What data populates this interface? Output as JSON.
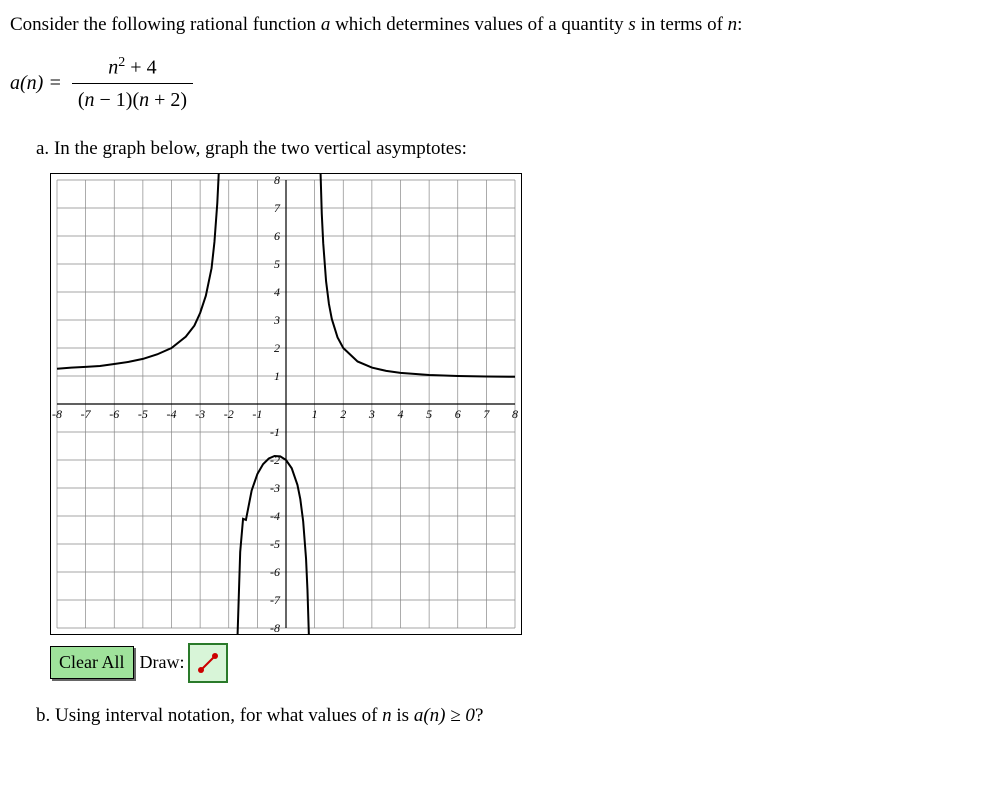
{
  "intro_prefix": "Consider the following rational function ",
  "intro_var1": "a",
  "intro_mid": " which determines values of a quantity ",
  "intro_var2": "s",
  "intro_mid2": " in terms of ",
  "intro_var3": "n",
  "intro_suffix": ":",
  "func_left": "a(n) = ",
  "numerator": "n² + 4",
  "denominator": "(n − 1)(n + 2)",
  "part_a_label": "a. ",
  "part_a_text": "In the graph below, graph the two vertical asymptotes:",
  "clear_label": "Clear All",
  "draw_label": "Draw:",
  "part_b_label": "b. ",
  "part_b_prefix": "Using interval notation, for what values of ",
  "part_b_var": "n",
  "part_b_mid": " is ",
  "part_b_fn": "a(n) ≥ 0",
  "part_b_suffix": "?",
  "chart_data": {
    "type": "line",
    "title": "",
    "xlabel": "",
    "ylabel": "",
    "xlim": [
      -8,
      8
    ],
    "ylim": [
      -8,
      8
    ],
    "xticks": [
      -8,
      -7,
      -6,
      -5,
      -4,
      -3,
      -2,
      -1,
      1,
      2,
      3,
      4,
      5,
      6,
      7,
      8
    ],
    "yticks": [
      -8,
      -7,
      -6,
      -5,
      -4,
      -3,
      -2,
      -1,
      1,
      2,
      3,
      4,
      5,
      6,
      7,
      8
    ],
    "vertical_asymptotes": [
      -2,
      1
    ],
    "horizontal_asymptote": 1,
    "function": "(n^2 + 4) / ((n - 1)(n + 2))",
    "curves": [
      {
        "name": "left_branch",
        "description": "x < -2",
        "points": [
          [
            -8.0,
            1.259
          ],
          [
            -7.5,
            1.3
          ],
          [
            -7.0,
            1.325
          ],
          [
            -6.5,
            1.358
          ],
          [
            -6.0,
            1.429
          ],
          [
            -5.5,
            1.504
          ],
          [
            -5.0,
            1.611
          ],
          [
            -4.5,
            1.773
          ],
          [
            -4.0,
            2.0
          ],
          [
            -3.5,
            2.405
          ],
          [
            -3.2,
            2.8
          ],
          [
            -3.0,
            3.25
          ],
          [
            -2.8,
            3.867
          ],
          [
            -2.6,
            4.852
          ],
          [
            -2.5,
            5.786
          ],
          [
            -2.4,
            7.176
          ],
          [
            -2.3,
            9.288
          ],
          [
            -2.25,
            11.019
          ]
        ]
      },
      {
        "name": "middle_branch",
        "description": "-2 < x < 1",
        "points": [
          [
            -1.85,
            -16.965
          ],
          [
            -1.8,
            -12.964
          ],
          [
            -1.7,
            -8.506
          ],
          [
            -1.6,
            -5.282
          ],
          [
            -1.5,
            -4.1
          ],
          [
            -1.4,
            -4.139
          ],
          [
            -1.2,
            -3.091
          ],
          [
            -1.0,
            -2.5
          ],
          [
            -0.8,
            -2.148
          ],
          [
            -0.6,
            -1.946
          ],
          [
            -0.4,
            -1.857
          ],
          [
            -0.2,
            -1.87
          ],
          [
            0.0,
            -2.0
          ],
          [
            0.2,
            -2.295
          ],
          [
            0.4,
            -2.889
          ],
          [
            0.5,
            -3.4
          ],
          [
            0.6,
            -4.192
          ],
          [
            0.7,
            -5.519
          ],
          [
            0.75,
            -6.645
          ],
          [
            0.8,
            -8.286
          ],
          [
            0.85,
            -10.988
          ]
        ]
      },
      {
        "name": "right_branch",
        "description": "x > 1",
        "points": [
          [
            1.15,
            10.989
          ],
          [
            1.2,
            8.5
          ],
          [
            1.25,
            6.788
          ],
          [
            1.3,
            5.747
          ],
          [
            1.4,
            4.382
          ],
          [
            1.5,
            3.571
          ],
          [
            1.6,
            3.037
          ],
          [
            1.8,
            2.382
          ],
          [
            2.0,
            2.0
          ],
          [
            2.5,
            1.519
          ],
          [
            3.0,
            1.3
          ],
          [
            3.5,
            1.182
          ],
          [
            4.0,
            1.111
          ],
          [
            5.0,
            1.036
          ],
          [
            6.0,
            1.0
          ],
          [
            7.0,
            0.981
          ],
          [
            8.0,
            0.971
          ]
        ]
      }
    ]
  }
}
